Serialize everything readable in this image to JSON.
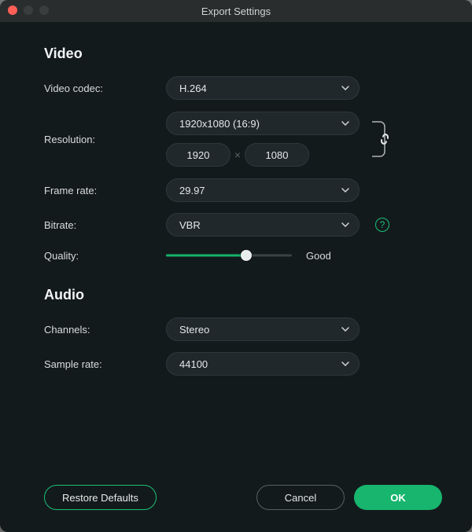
{
  "window": {
    "title": "Export Settings"
  },
  "sections": {
    "video": "Video",
    "audio": "Audio"
  },
  "video": {
    "codec": {
      "label": "Video codec:",
      "value": "H.264"
    },
    "resolution": {
      "label": "Resolution:",
      "preset": "1920x1080 (16:9)",
      "w": "1920",
      "h": "1080",
      "sep": "×"
    },
    "framerate": {
      "label": "Frame rate:",
      "value": "29.97"
    },
    "bitrate": {
      "label": "Bitrate:",
      "value": "VBR"
    },
    "quality": {
      "label": "Quality:",
      "percent": 64,
      "text": "Good"
    }
  },
  "audio": {
    "channels": {
      "label": "Channels:",
      "value": "Stereo"
    },
    "samplerate": {
      "label": "Sample rate:",
      "value": "44100"
    }
  },
  "footer": {
    "restore": "Restore Defaults",
    "cancel": "Cancel",
    "ok": "OK"
  },
  "icons": {
    "help_glyph": "?"
  },
  "colors": {
    "accent": "#17b56e",
    "accent_border": "#1bbf78",
    "bg": "#131a1c",
    "pill": "#20282b"
  }
}
